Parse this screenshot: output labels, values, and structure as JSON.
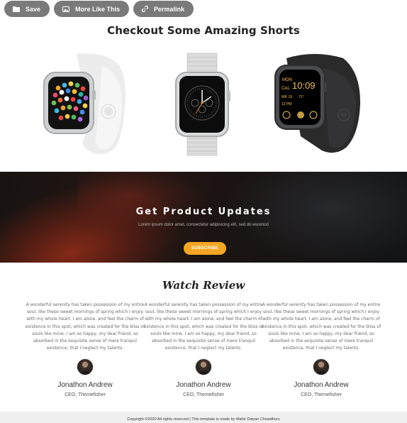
{
  "toolbar": {
    "save_label": "Save",
    "more_label": "More Like This",
    "permalink_label": "Permalink"
  },
  "shorts": {
    "title": "Checkout Some Amazing Shorts",
    "watch3_time": "10:09"
  },
  "newsletter": {
    "title": "Get Product Updates",
    "subtitle": "Lorem ipsum dolor amet, consectetur adipisicing elit, sed do eiusmod",
    "button": "SUBSCRIBE"
  },
  "reviews": {
    "title": "Watch Review",
    "items": [
      {
        "text": "A wonderful serenity has taken possession of my entire soul, like these sweet mornings of spring which I enjoy with my whole heart. I am alone, and feel the charm of existence in this spot, which was created for the bliss of souls like mine. I am so happy, my dear friend, so absorbed in the exquisite sense of mere tranquil existence, that I neglect my talents.",
        "name": "Jonathon Andrew",
        "role": "CEO, Themefisher"
      },
      {
        "text": "A wonderful serenity has taken possession of my entire soul, like these sweet mornings of spring which I enjoy with my whole heart. I am alone, and feel the charm of existence in this spot, which was created for the bliss of souls like mine. I am so happy, my dear friend, so absorbed in the exquisite sense of mere tranquil existence, that I neglect my talents.",
        "name": "Jonathon Andrew",
        "role": "CEO, Themefisher"
      },
      {
        "text": "A wonderful serenity has taken possession of my entire soul, like these sweet mornings of spring which I enjoy with my whole heart. I am alone, and feel the charm of existence in this spot, which was created for the bliss of souls like mine. I am so happy, my dear friend, so absorbed in the exquisite sense of mere tranquil existence, that I neglect my talents.",
        "name": "Jonathon Andrew",
        "role": "CEO, Themefisher"
      }
    ]
  },
  "footer": {
    "text": "Copyright ©2020 All rights reserved | This template is made by Mahir Daiyan Chowdhury"
  },
  "colors": {
    "button_gray": "#7a7a7a",
    "accent_orange": "#f5a623",
    "footer_bg": "#f0f0f0"
  },
  "icons": [
    "folder-icon",
    "image-icon",
    "link-icon"
  ]
}
